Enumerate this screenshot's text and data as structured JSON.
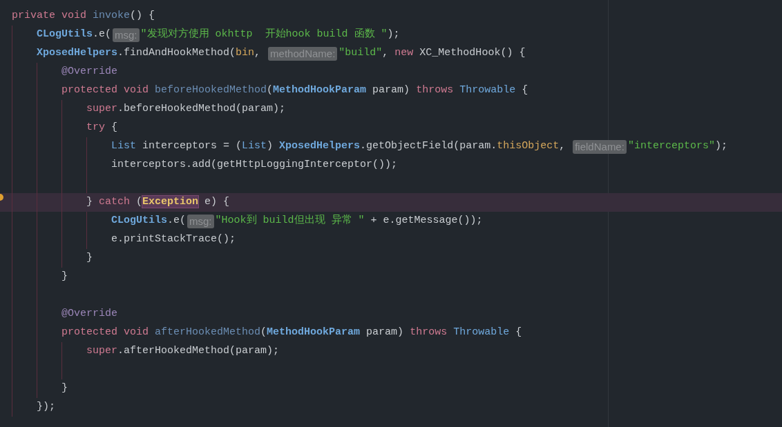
{
  "editor": {
    "lines": [
      {
        "current": false,
        "tokens": [
          {
            "kind": "kw",
            "text": "private "
          },
          {
            "kind": "kw",
            "text": "void "
          },
          {
            "kind": "fn",
            "text": "invoke"
          },
          {
            "kind": "p",
            "text": "() {"
          }
        ],
        "children": [
          {
            "current": false,
            "tokens": [
              {
                "kind": "cls",
                "text": "CLogUtils"
              },
              {
                "kind": "p",
                "text": ".e("
              },
              {
                "kind": "hint",
                "text": "msg:"
              },
              {
                "kind": "str",
                "text": "\"发现对方使用 okhttp  开始hook build 函数 \""
              },
              {
                "kind": "p",
                "text": ");"
              }
            ]
          },
          {
            "current": false,
            "tokens": [
              {
                "kind": "cls",
                "text": "XposedHelpers"
              },
              {
                "kind": "p",
                "text": ".findAndHookMethod("
              },
              {
                "kind": "fld",
                "text": "bin"
              },
              {
                "kind": "p",
                "text": ", "
              },
              {
                "kind": "hint",
                "text": "methodName:"
              },
              {
                "kind": "str",
                "text": "\"build\""
              },
              {
                "kind": "p",
                "text": ", "
              },
              {
                "kind": "kw",
                "text": "new"
              },
              {
                "kind": "p",
                "text": " XC_MethodHook() {"
              }
            ],
            "children": [
              {
                "current": false,
                "tokens": [
                  {
                    "kind": "ann",
                    "text": "@Override"
                  }
                ]
              },
              {
                "current": false,
                "tokens": [
                  {
                    "kind": "kw",
                    "text": "protected "
                  },
                  {
                    "kind": "kw",
                    "text": "void "
                  },
                  {
                    "kind": "fn",
                    "text": "beforeHookedMethod"
                  },
                  {
                    "kind": "p",
                    "text": "("
                  },
                  {
                    "kind": "typ",
                    "text": "MethodHookParam"
                  },
                  {
                    "kind": "p",
                    "text": " param) "
                  },
                  {
                    "kind": "kw",
                    "text": "throws "
                  },
                  {
                    "kind": "ref",
                    "text": "Throwable"
                  },
                  {
                    "kind": "p",
                    "text": " {"
                  }
                ],
                "children": [
                  {
                    "current": false,
                    "tokens": [
                      {
                        "kind": "kw",
                        "text": "super"
                      },
                      {
                        "kind": "p",
                        "text": ".beforeHookedMethod(param);"
                      }
                    ]
                  },
                  {
                    "current": false,
                    "tokens": [
                      {
                        "kind": "kw",
                        "text": "try"
                      },
                      {
                        "kind": "p",
                        "text": " {"
                      }
                    ],
                    "children": [
                      {
                        "current": false,
                        "tokens": [
                          {
                            "kind": "ref",
                            "text": "List"
                          },
                          {
                            "kind": "p",
                            "text": " interceptors = ("
                          },
                          {
                            "kind": "ref",
                            "text": "List"
                          },
                          {
                            "kind": "p",
                            "text": ") "
                          },
                          {
                            "kind": "cls",
                            "text": "XposedHelpers"
                          },
                          {
                            "kind": "p",
                            "text": ".getObjectField(param."
                          },
                          {
                            "kind": "fld",
                            "text": "thisObject"
                          },
                          {
                            "kind": "p",
                            "text": ", "
                          },
                          {
                            "kind": "hint",
                            "text": "fieldName:"
                          },
                          {
                            "kind": "str",
                            "text": "\"interceptors\""
                          },
                          {
                            "kind": "p",
                            "text": ");"
                          }
                        ]
                      },
                      {
                        "current": false,
                        "tokens": [
                          {
                            "kind": "p",
                            "text": "interceptors.add(getHttpLoggingInterceptor());"
                          }
                        ]
                      },
                      {
                        "current": false
                      }
                    ]
                  },
                  {
                    "current": true,
                    "tokens": [
                      {
                        "kind": "p",
                        "text": "} "
                      },
                      {
                        "kind": "kw",
                        "text": "catch"
                      },
                      {
                        "kind": "p",
                        "text": " ("
                      },
                      {
                        "kind": "match",
                        "text": "Exception"
                      },
                      {
                        "kind": "p",
                        "text": " e) {"
                      }
                    ],
                    "children": [
                      {
                        "current": false,
                        "tokens": [
                          {
                            "kind": "cls",
                            "text": "CLogUtils"
                          },
                          {
                            "kind": "p",
                            "text": ".e("
                          },
                          {
                            "kind": "hint",
                            "text": "msg:"
                          },
                          {
                            "kind": "str",
                            "text": "\"Hook到 build但出现 异常 \""
                          },
                          {
                            "kind": "p",
                            "text": " + e.getMessage());"
                          }
                        ]
                      },
                      {
                        "current": false,
                        "tokens": [
                          {
                            "kind": "p",
                            "text": "e.printStackTrace();"
                          }
                        ]
                      }
                    ]
                  },
                  {
                    "current": false,
                    "tokens": [
                      {
                        "kind": "p",
                        "text": "}"
                      }
                    ]
                  }
                ]
              },
              {
                "current": false,
                "tokens": [
                  {
                    "kind": "p",
                    "text": "}"
                  }
                ]
              },
              {
                "current": false
              },
              {
                "current": false,
                "tokens": [
                  {
                    "kind": "ann",
                    "text": "@Override"
                  }
                ]
              },
              {
                "current": false,
                "tokens": [
                  {
                    "kind": "kw",
                    "text": "protected "
                  },
                  {
                    "kind": "kw",
                    "text": "void "
                  },
                  {
                    "kind": "fn",
                    "text": "afterHookedMethod"
                  },
                  {
                    "kind": "p",
                    "text": "("
                  },
                  {
                    "kind": "typ",
                    "text": "MethodHookParam"
                  },
                  {
                    "kind": "p",
                    "text": " param) "
                  },
                  {
                    "kind": "kw",
                    "text": "throws "
                  },
                  {
                    "kind": "ref",
                    "text": "Throwable"
                  },
                  {
                    "kind": "p",
                    "text": " {"
                  }
                ],
                "children": [
                  {
                    "current": false,
                    "tokens": [
                      {
                        "kind": "kw",
                        "text": "super"
                      },
                      {
                        "kind": "p",
                        "text": ".afterHookedMethod(param);"
                      }
                    ]
                  },
                  {
                    "current": false
                  }
                ]
              },
              {
                "current": false,
                "tokens": [
                  {
                    "kind": "p",
                    "text": "}"
                  }
                ]
              }
            ]
          },
          {
            "current": false,
            "tokens": [
              {
                "kind": "p",
                "text": "});"
              }
            ]
          }
        ]
      }
    ]
  }
}
